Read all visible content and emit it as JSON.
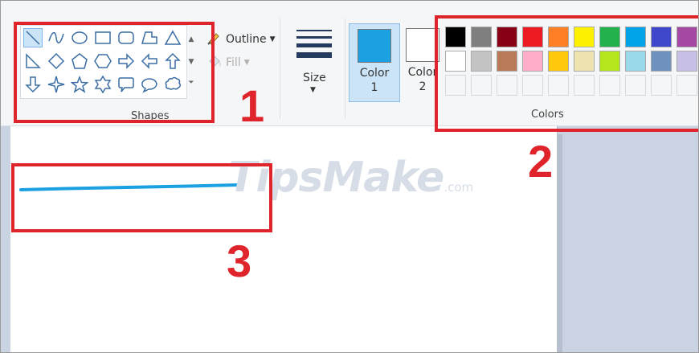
{
  "ribbon": {
    "shapes": {
      "group_label": "Shapes",
      "items": [
        "line-icon",
        "curve-icon",
        "oval-icon",
        "rectangle-icon",
        "rounded-rectangle-icon",
        "polygon-icon",
        "triangle-icon",
        "right-triangle-icon",
        "diamond-icon",
        "pentagon-icon",
        "hexagon-icon",
        "right-arrow-icon",
        "left-arrow-icon",
        "up-arrow-icon",
        "down-arrow-icon",
        "four-point-star-icon",
        "five-point-star-icon",
        "six-point-star-icon",
        "rounded-callout-icon",
        "oval-callout-icon",
        "cloud-callout-icon"
      ],
      "selected_index": 0
    },
    "outline_label": "Outline",
    "fill_label": "Fill",
    "size_label": "Size",
    "color1": {
      "label": "Color",
      "number": "1",
      "color": "#1ba1e2"
    },
    "color2": {
      "label": "Color",
      "number": "2",
      "color": "#ffffff"
    },
    "colors": {
      "group_label": "Colors",
      "row1": [
        "#000000",
        "#7f7f7f",
        "#880015",
        "#ed1c24",
        "#ff7f27",
        "#fff200",
        "#22b14c",
        "#00a2e8",
        "#3f48cc",
        "#a349a4"
      ],
      "row2": [
        "#ffffff",
        "#c3c3c3",
        "#b97a57",
        "#ffaec9",
        "#ffc90e",
        "#efe4b0",
        "#b5e61d",
        "#99d9ea",
        "#7092be",
        "#c8bfe7"
      ]
    }
  },
  "canvas": {
    "stroke_color": "#1ba1e2"
  },
  "watermark": {
    "brand": "TipsMake",
    "suffix": ".com"
  },
  "annotations": [
    "1",
    "2",
    "3"
  ]
}
